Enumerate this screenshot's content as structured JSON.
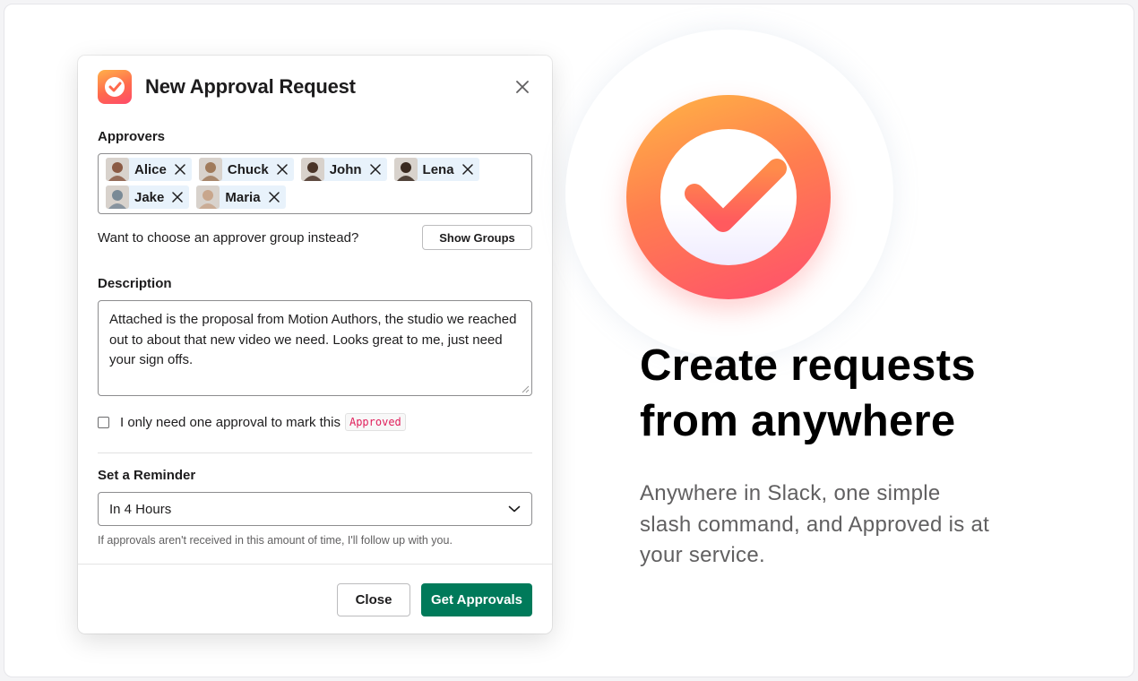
{
  "modal": {
    "title": "New Approval Request",
    "app_icon": "approved-check-icon",
    "close_icon": "close-icon",
    "approvers_label": "Approvers",
    "approvers": [
      {
        "name": "Alice",
        "avatar_color": "#8a5a44"
      },
      {
        "name": "Chuck",
        "avatar_color": "#a07a5a"
      },
      {
        "name": "John",
        "avatar_color": "#4a3428"
      },
      {
        "name": "Lena",
        "avatar_color": "#3a2a20"
      },
      {
        "name": "Jake",
        "avatar_color": "#7a8a96"
      },
      {
        "name": "Maria",
        "avatar_color": "#c8a68c"
      }
    ],
    "group_prompt": "Want to choose an approver group instead?",
    "show_groups_label": "Show Groups",
    "description_label": "Description",
    "description_value": "Attached is the proposal from Motion Authors, the studio we reached out to about that new video we need. Looks great to me, just need your sign offs.",
    "single_approval_text": "I only need one approval to mark this",
    "single_approval_badge": "Approved",
    "single_approval_checked": false,
    "reminder_label": "Set a Reminder",
    "reminder_value": "In 4 Hours",
    "reminder_hint": "If approvals aren't received in this amount of time, I'll follow up with you.",
    "close_button": "Close",
    "submit_button": "Get Approvals"
  },
  "promo": {
    "logo_icon": "approved-check-icon",
    "headline_line1": "Create requests",
    "headline_line2": "from anywhere",
    "subtext_line1": "Anywhere in Slack, one simple",
    "subtext_line2": "slash command, and Approved is at",
    "subtext_line3": "your service."
  },
  "colors": {
    "primary_button": "#007a5a",
    "brand_orange": "#ff7e4f",
    "brand_pink": "#ff4d6e",
    "chip_bg": "#e8f2fb",
    "badge_text": "#e01e5a"
  }
}
